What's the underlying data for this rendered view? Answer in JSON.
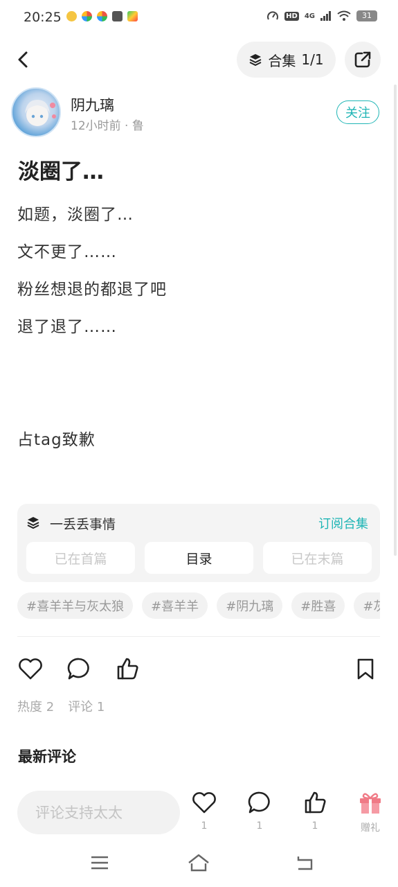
{
  "status_bar": {
    "time": "20:25",
    "hd": "HD",
    "network": "4G",
    "battery": "31"
  },
  "header": {
    "collection_label": "合集",
    "collection_index": "1/1"
  },
  "author": {
    "name": "阴九璃",
    "meta": "12小时前 · 鲁",
    "follow_label": "关注"
  },
  "post": {
    "title": "淡圈了…",
    "lines": [
      "如题，淡圈了…",
      "文不更了……",
      "粉丝想退的都退了吧",
      "退了退了……",
      "占tag致歉"
    ]
  },
  "collection_card": {
    "title": "一丢丢事情",
    "subscribe_label": "订阅合集",
    "prev_label": "已在首篇",
    "toc_label": "目录",
    "next_label": "已在末篇"
  },
  "tags": [
    "#喜羊羊与灰太狼",
    "#喜羊羊",
    "#阴九璃",
    "#胜喜",
    "#灰太狼"
  ],
  "stats": {
    "heat": "热度 2",
    "comments": "评论 1"
  },
  "latest_comments_label": "最新评论",
  "bottom_bar": {
    "comment_placeholder": "评论支持太太",
    "like_count": "1",
    "comment_count": "1",
    "recommend_count": "1",
    "gift_label": "赠礼"
  },
  "colors": {
    "accent": "#1fb5b5",
    "gift": "#f07a86"
  },
  "icons": [
    "back-arrow-icon",
    "layers-icon",
    "share-icon",
    "heart-icon",
    "comment-icon",
    "thumbs-up-icon",
    "bookmark-icon",
    "gift-icon",
    "menu-icon",
    "home-icon",
    "return-icon"
  ]
}
